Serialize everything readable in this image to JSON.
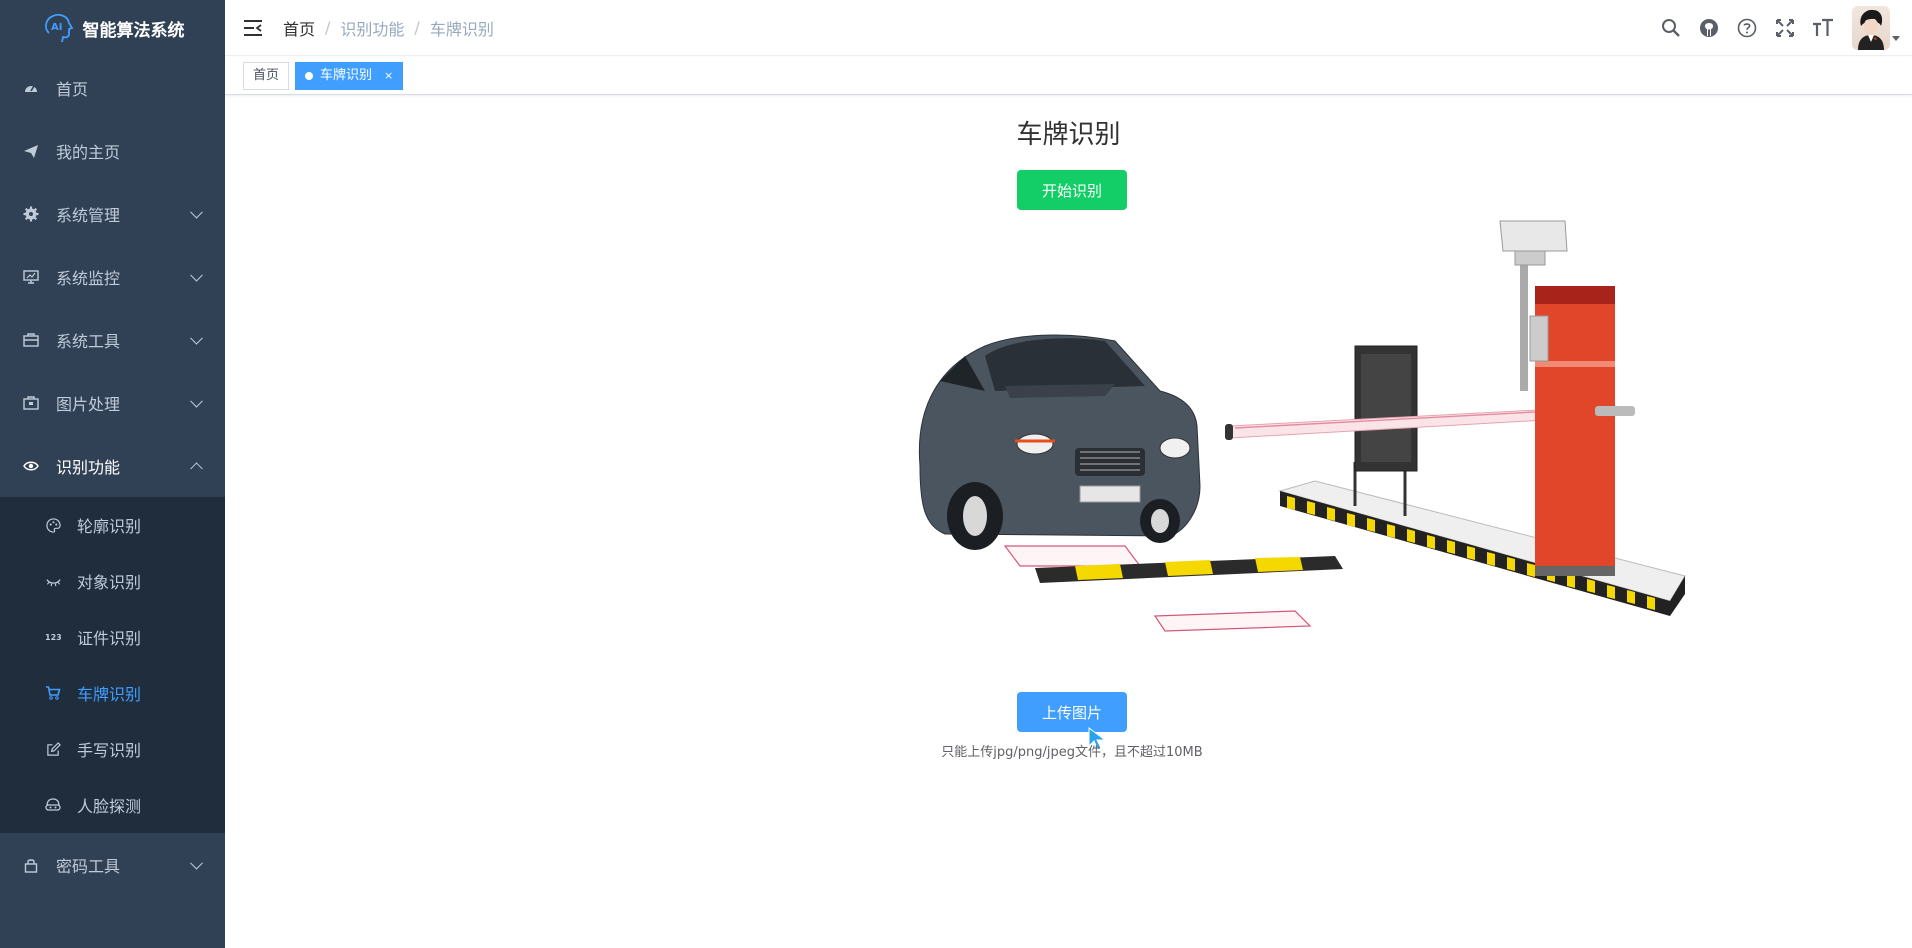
{
  "app": {
    "title": "智能算法系统"
  },
  "sidebar": {
    "items": [
      {
        "label": "首页",
        "icon": "dashboard-icon"
      },
      {
        "label": "我的主页",
        "icon": "send-icon"
      },
      {
        "label": "系统管理",
        "icon": "gear-icon"
      },
      {
        "label": "系统监控",
        "icon": "monitor-icon"
      },
      {
        "label": "系统工具",
        "icon": "toolbox-icon"
      },
      {
        "label": "图片处理",
        "icon": "image-box-icon"
      },
      {
        "label": "识别功能",
        "icon": "eye-icon"
      }
    ],
    "recognition_sub": [
      {
        "label": "轮廓识别",
        "icon": "palette-icon"
      },
      {
        "label": "对象识别",
        "icon": "eye-closed-icon"
      },
      {
        "label": "证件识别",
        "icon": "number-123-icon"
      },
      {
        "label": "车牌识别",
        "icon": "cart-icon"
      },
      {
        "label": "手写识别",
        "icon": "edit-icon"
      },
      {
        "label": "人脸探测",
        "icon": "face-icon"
      }
    ],
    "last_item": {
      "label": "密码工具",
      "icon": "lock-icon"
    }
  },
  "header": {
    "breadcrumb": [
      "首页",
      "识别功能",
      "车牌识别"
    ],
    "separator": "/"
  },
  "tags": [
    {
      "label": "首页",
      "active": false
    },
    {
      "label": "车牌识别",
      "active": true,
      "close": "×"
    }
  ],
  "main": {
    "title": "车牌识别",
    "start_button": "开始识别",
    "upload_button": "上传图片",
    "upload_tip": "只能上传jpg/png/jpeg文件，且不超过10MB"
  },
  "colors": {
    "sidebar_bg": "#304156",
    "submenu_bg": "#1f2d3d",
    "active": "#409eff",
    "success": "#13ce66"
  }
}
